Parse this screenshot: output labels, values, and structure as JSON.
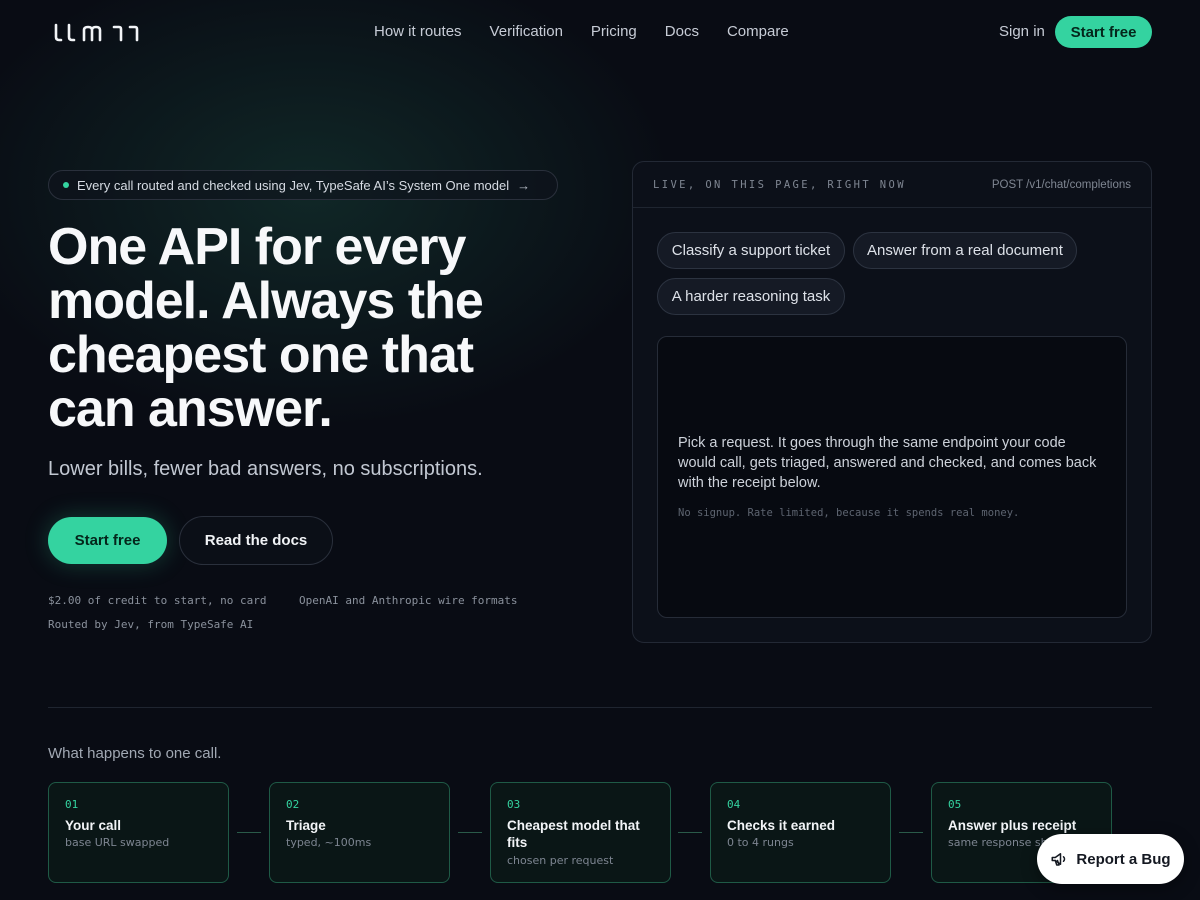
{
  "nav": {
    "logo_text": "llm11",
    "links": [
      "How it routes",
      "Verification",
      "Pricing",
      "Docs",
      "Compare"
    ],
    "sign_in": "Sign in",
    "cta": "Start free"
  },
  "hero": {
    "pill_text": "Every call routed and checked using Jev, TypeSafe AI’s System One model",
    "pill_arrow": "→",
    "headline": "One API for every model. Always the cheapest one that can answer.",
    "subhead": "Lower bills, fewer bad answers, no subscriptions.",
    "primary_cta": "Start free",
    "secondary_cta": "Read the docs",
    "meta": [
      "$2.00 of credit to start, no card",
      "OpenAI and Anthropic wire formats",
      "Routed by Jev, from TypeSafe AI"
    ]
  },
  "demo": {
    "live_label": "LIVE, ON THIS PAGE, RIGHT NOW",
    "endpoint": "POST /v1/chat/completions",
    "chips": [
      "Classify a support ticket",
      "Answer from a real document",
      "A harder reasoning task"
    ],
    "output_text": "Pick a request. It goes through the same endpoint your code would call, gets triaged, answered and checked, and comes back with the receipt below.",
    "output_note": "No signup. Rate limited, because it spends real money."
  },
  "pipeline": {
    "label": "What happens to one call.",
    "steps": [
      {
        "num": "01",
        "title": "Your call",
        "sub": "base URL swapped"
      },
      {
        "num": "02",
        "title": "Triage",
        "sub": "typed, ~100ms"
      },
      {
        "num": "03",
        "title": "Cheapest model that fits",
        "sub": "chosen per request"
      },
      {
        "num": "04",
        "title": "Checks it earned",
        "sub": "0 to 4 rungs"
      },
      {
        "num": "05",
        "title": "Answer plus receipt",
        "sub": "same response shape"
      }
    ]
  },
  "report_bug": "Report a Bug",
  "colors": {
    "accent": "#34d3a0",
    "background": "#090c14"
  }
}
